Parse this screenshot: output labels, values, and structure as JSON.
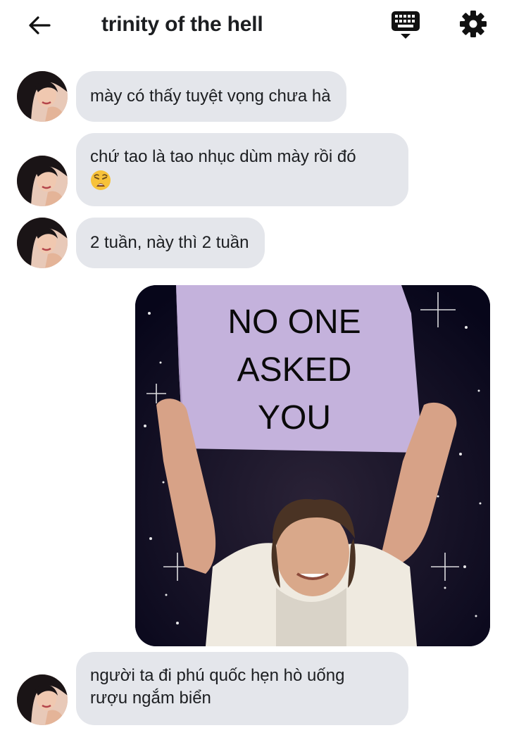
{
  "header": {
    "back_icon": "arrow-left-icon",
    "title": "trinity of the hell",
    "keyboard_icon": "keyboard-icon",
    "settings_icon": "gear-icon"
  },
  "messages": [
    {
      "type": "text",
      "sender": "other",
      "text": "mày có thấy tuyệt vọng chưa hà"
    },
    {
      "type": "text",
      "sender": "other",
      "text": "chứ tao là tao nhục dùm mày rồi đó",
      "emoji": "weary-face-emoji"
    },
    {
      "type": "text",
      "sender": "other",
      "text": "2 tuần, này thì 2 tuần"
    },
    {
      "type": "image",
      "sender": "me",
      "caption_lines": [
        "NO ONE",
        "ASKED",
        "YOU"
      ]
    },
    {
      "type": "text",
      "sender": "other",
      "lines": [
        "người ta đi phú quốc hẹn hò uống",
        "rượu ngắm biển"
      ]
    }
  ],
  "colors": {
    "bubble_bg": "#e4e6eb",
    "text": "#1c1e21",
    "meme_sign": "#c4b2dc",
    "meme_bg": "#0c0a1e"
  }
}
